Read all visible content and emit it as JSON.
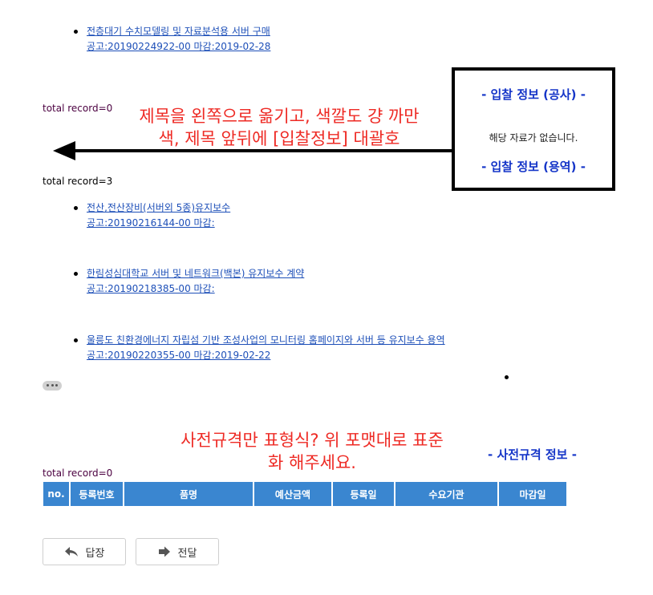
{
  "list_top": [
    {
      "title": "전층대기 수치모델링 및 자료분석용 서버 구매",
      "notice": "공고:20190224922-00 마감:2019-02-28"
    }
  ],
  "record_1": "total record=0",
  "record_2": "total record=3",
  "record_3": "total record=0",
  "box": {
    "heading_construction": "- 입찰 정보 (공사) -",
    "empty_message": "해당 자료가 없습니다.",
    "heading_service": "- 입찰 정보 (용역) -"
  },
  "annotation_1": {
    "line1": "제목을 왼쪽으로 옮기고, 색깔도 걍 까만",
    "line2": "색, 제목 앞뒤에 [입찰정보] 대괄호"
  },
  "list_service": [
    {
      "title": "전산,전산장비(서버외 5종)유지보수",
      "notice": "공고:20190216144-00 마감:"
    },
    {
      "title": "한림성심대학교 서버 및 네트워크(백본) 유지보수 계약",
      "notice": "공고:20190218385-00 마감:"
    },
    {
      "title": "울릉도 친환경에너지 자립섬 기반 조성사업의 모니터링 홈페이지와 서버 등 유지보수 용역",
      "notice": "공고:20190220355-00 마감:2019-02-22"
    }
  ],
  "annotation_2": {
    "line1": "사전규격만 표형식? 위 포맷대로 표준",
    "line2": "화 해주세요."
  },
  "pre_spec_heading": "- 사전규격 정보 -",
  "table": {
    "headers": [
      "no.",
      "등록번호",
      "품명",
      "예산금액",
      "등록일",
      "수요기관",
      "마감일"
    ]
  },
  "buttons": {
    "reply": "답장",
    "forward": "전달"
  },
  "colors": {
    "link": "#1d4fb8",
    "annotation": "#ee2a24",
    "heading_blue": "#1535c8",
    "table_header": "#3a86d0"
  },
  "icons": [
    "reply-arrow-icon",
    "forward-arrow-icon",
    "left-arrow-icon",
    "more-dots-icon"
  ]
}
